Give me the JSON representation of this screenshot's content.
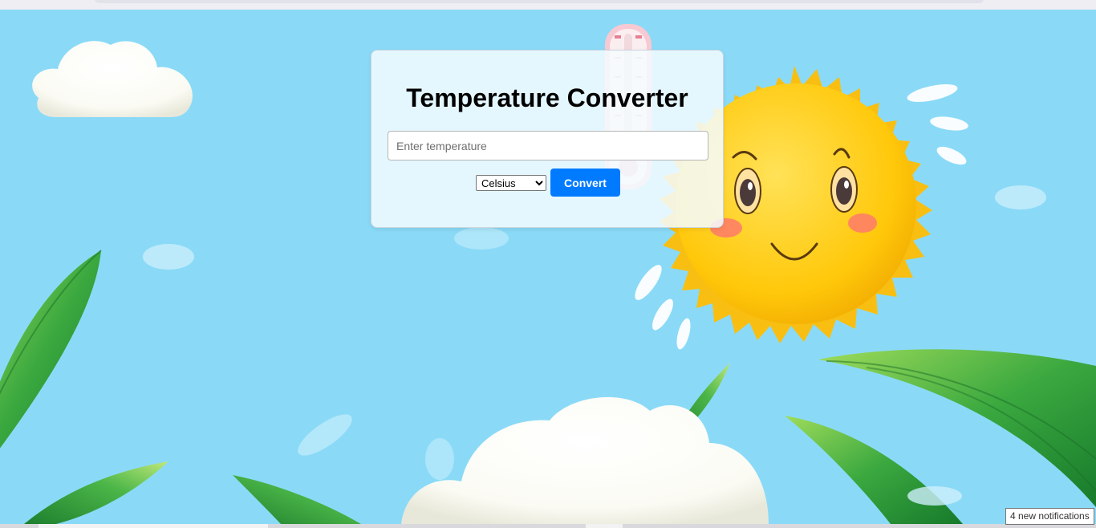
{
  "page": {
    "title": "Temperature Converter"
  },
  "form": {
    "input_placeholder": "Enter temperature",
    "input_value": "",
    "unit_selected": "Celsius",
    "unit_options": [
      "Celsius"
    ],
    "convert_label": "Convert"
  },
  "notifications": {
    "tooltip": "4 new notifications"
  },
  "colors": {
    "sky": "#8adaf7",
    "button": "#007bff",
    "sun": "#ffcc1a",
    "leaf": "#2e9a3c"
  },
  "icons": {
    "background": "sunny-sky-illustration"
  }
}
